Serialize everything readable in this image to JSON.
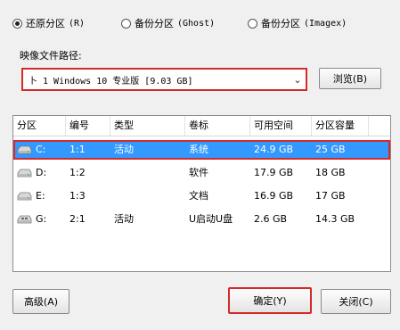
{
  "radios": [
    {
      "label": "还原分区",
      "hotkey": "(R)",
      "checked": true
    },
    {
      "label": "备份分区",
      "hotkey": "(Ghost)",
      "checked": false
    },
    {
      "label": "备份分区",
      "hotkey": "(Imagex)",
      "checked": false
    }
  ],
  "image_path": {
    "label": "映像文件路径:",
    "value": "卜 1 Windows 10 专业版 [9.03 GB]",
    "dropdown_icon": "chevron-down-icon"
  },
  "browse_label": "浏览(B)",
  "table": {
    "headers": [
      "分区",
      "编号",
      "类型",
      "卷标",
      "可用空间",
      "分区容量"
    ],
    "rows": [
      {
        "drive": "C:",
        "number": "1:1",
        "type": "活动",
        "label": "系统",
        "free": "24.9 GB",
        "size": "25 GB",
        "selected": true,
        "icon": "hard-drive-icon"
      },
      {
        "drive": "D:",
        "number": "1:2",
        "type": "",
        "label": "软件",
        "free": "17.9 GB",
        "size": "18 GB",
        "selected": false,
        "icon": "hard-drive-icon"
      },
      {
        "drive": "E:",
        "number": "1:3",
        "type": "",
        "label": "文档",
        "free": "16.9 GB",
        "size": "17 GB",
        "selected": false,
        "icon": "hard-drive-icon"
      },
      {
        "drive": "G:",
        "number": "2:1",
        "type": "活动",
        "label": "U启动U盘",
        "free": "2.6 GB",
        "size": "14.3 GB",
        "selected": false,
        "icon": "usb-drive-icon"
      }
    ]
  },
  "buttons": {
    "advanced": "高级(A)",
    "ok": "确定(Y)",
    "close": "关闭(C)"
  },
  "colors": {
    "highlight": "#3399ff",
    "annotation_red": "#d42a2a"
  }
}
